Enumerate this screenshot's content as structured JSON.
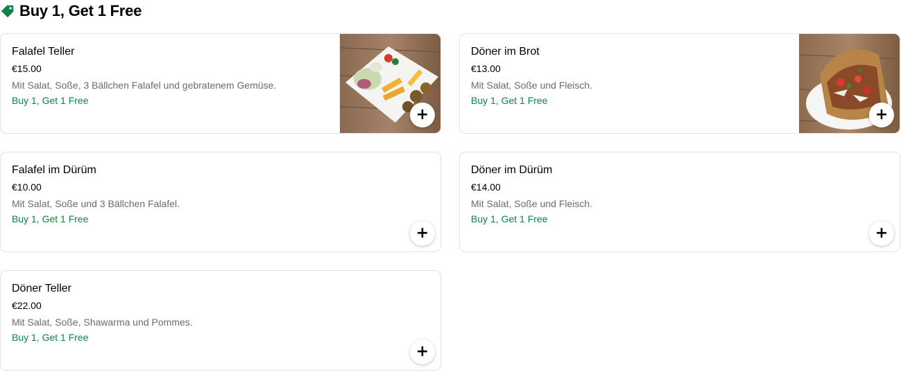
{
  "section": {
    "title": "Buy 1, Get 1 Free",
    "icon": "tag-icon",
    "accent": "#0e8345"
  },
  "items": [
    {
      "name": "Falafel Teller",
      "price": "€15.00",
      "description": "Mit Salat, Soße, 3 Bällchen Falafel und gebratenem Gemüse.",
      "promo": "Buy 1, Get 1 Free",
      "add_label": "+",
      "has_image": true
    },
    {
      "name": "Döner im Brot",
      "price": "€13.00",
      "description": "Mit Salat, Soße und Fleisch.",
      "promo": "Buy 1, Get 1 Free",
      "add_label": "+",
      "has_image": true
    },
    {
      "name": "Falafel im Dürüm",
      "price": "€10.00",
      "description": "Mit Salat, Soße und 3 Bällchen Falafel.",
      "promo": "Buy 1, Get 1 Free",
      "add_label": "+",
      "has_image": false
    },
    {
      "name": "Döner im Dürüm",
      "price": "€14.00",
      "description": "Mit Salat, Soße und Fleisch.",
      "promo": "Buy 1, Get 1 Free",
      "add_label": "+",
      "has_image": false
    },
    {
      "name": "Döner Teller",
      "price": "€22.00",
      "description": "Mit Salat, Soße, Shawarma und Pommes.",
      "promo": "Buy 1, Get 1 Free",
      "add_label": "+",
      "has_image": false
    }
  ]
}
